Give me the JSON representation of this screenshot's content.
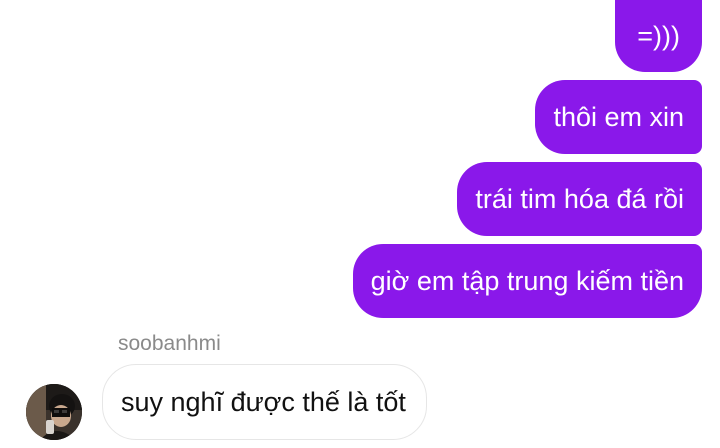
{
  "conversation": {
    "outgoing": [
      {
        "text": "=)))"
      },
      {
        "text": "thôi em xin"
      },
      {
        "text": "trái tim hóa đá rồi"
      },
      {
        "text": "giờ em tập trung kiếm tiền"
      }
    ],
    "incoming": {
      "sender": "soobanhmi",
      "text": "suy nghĩ được thế là tốt",
      "avatar_icon": "profile-photo"
    }
  },
  "colors": {
    "outgoing_bubble": "#8a18ea",
    "incoming_bubble_border": "#e6e6e6",
    "sender_name": "#8a8a8a"
  }
}
